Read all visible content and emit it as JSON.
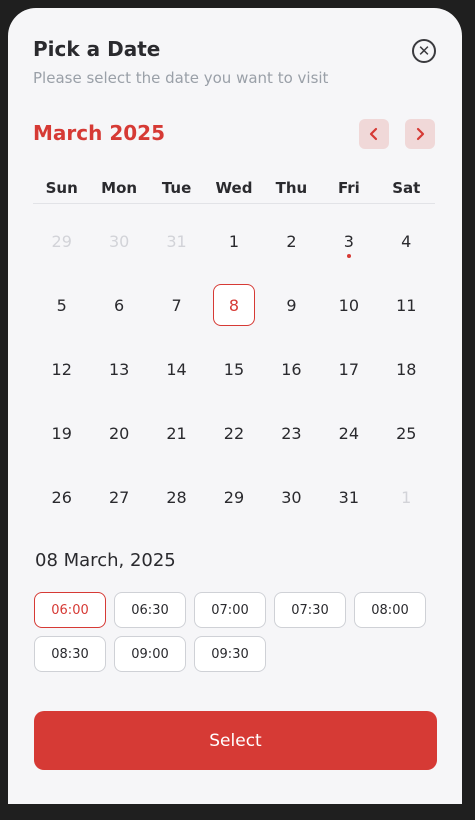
{
  "header": {
    "title": "Pick a Date",
    "subtitle": "Please select the date you want to visit",
    "close_icon": "close-circle-icon"
  },
  "calendar": {
    "month_label": "March 2025",
    "prev_icon": "chevron-left-icon",
    "next_icon": "chevron-right-icon",
    "weekdays": [
      "Sun",
      "Mon",
      "Tue",
      "Wed",
      "Thu",
      "Fri",
      "Sat"
    ],
    "days": [
      {
        "label": "29",
        "state": "muted"
      },
      {
        "label": "30",
        "state": "muted"
      },
      {
        "label": "31",
        "state": "muted"
      },
      {
        "label": "1"
      },
      {
        "label": "2"
      },
      {
        "label": "3",
        "event": true
      },
      {
        "label": "4"
      },
      {
        "label": "5"
      },
      {
        "label": "6"
      },
      {
        "label": "7"
      },
      {
        "label": "8",
        "state": "selected"
      },
      {
        "label": "9"
      },
      {
        "label": "10"
      },
      {
        "label": "11"
      },
      {
        "label": "12"
      },
      {
        "label": "13"
      },
      {
        "label": "14"
      },
      {
        "label": "15"
      },
      {
        "label": "16"
      },
      {
        "label": "17"
      },
      {
        "label": "18"
      },
      {
        "label": "19"
      },
      {
        "label": "20"
      },
      {
        "label": "21"
      },
      {
        "label": "22"
      },
      {
        "label": "23"
      },
      {
        "label": "24"
      },
      {
        "label": "25"
      },
      {
        "label": "26"
      },
      {
        "label": "27"
      },
      {
        "label": "28"
      },
      {
        "label": "29"
      },
      {
        "label": "30"
      },
      {
        "label": "31"
      },
      {
        "label": "1",
        "state": "muted"
      }
    ]
  },
  "selection": {
    "date_heading": "08 March, 2025",
    "times": [
      {
        "label": "06:00",
        "active": true
      },
      {
        "label": "06:30"
      },
      {
        "label": "07:00"
      },
      {
        "label": "07:30"
      },
      {
        "label": "08:00"
      },
      {
        "label": "08:30"
      },
      {
        "label": "09:00"
      },
      {
        "label": "09:30"
      }
    ]
  },
  "actions": {
    "select_label": "Select"
  },
  "colors": {
    "accent": "#d63a35",
    "accent_soft": "#f0d8d8",
    "text": "#2a2a2e",
    "muted": "#d2d3d8",
    "background": "#f6f6f8"
  }
}
